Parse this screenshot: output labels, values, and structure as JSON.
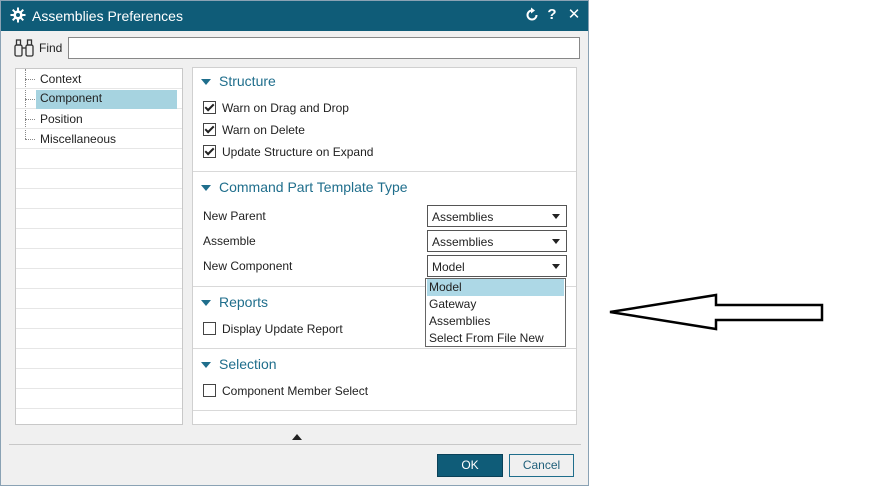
{
  "window": {
    "title": "Assemblies Preferences",
    "title_bar_color": "#0f5c78",
    "buttons": {
      "reset_icon": "reset-icon",
      "help_glyph": "?",
      "close_glyph": "✕"
    }
  },
  "find": {
    "label": "Find",
    "value": "",
    "placeholder": ""
  },
  "tree": {
    "items": [
      {
        "label": "Context",
        "selected": false
      },
      {
        "label": "Component",
        "selected": true
      },
      {
        "label": "Position",
        "selected": false
      },
      {
        "label": "Miscellaneous",
        "selected": false
      }
    ]
  },
  "sections": {
    "structure": {
      "title": "Structure",
      "options": [
        {
          "label": "Warn on Drag and Drop",
          "checked": true
        },
        {
          "label": "Warn on Delete",
          "checked": true
        },
        {
          "label": "Update Structure on Expand",
          "checked": true
        }
      ]
    },
    "template": {
      "title": "Command Part Template Type",
      "fields": [
        {
          "label": "New Parent",
          "value": "Assemblies"
        },
        {
          "label": "Assemble",
          "value": "Assemblies"
        },
        {
          "label": "New Component",
          "value": "Model"
        }
      ],
      "dropdown_options": [
        "Model",
        "Gateway",
        "Assemblies",
        "Select From File New"
      ],
      "dropdown_highlight": "Model"
    },
    "reports": {
      "title": "Reports",
      "options": [
        {
          "label": "Display Update Report",
          "checked": false
        }
      ]
    },
    "selection": {
      "title": "Selection",
      "options": [
        {
          "label": "Component Member Select",
          "checked": false
        }
      ]
    }
  },
  "footer": {
    "ok_label": "OK",
    "cancel_label": "Cancel"
  },
  "colors": {
    "accent": "#1f6e8c",
    "selection": "#a6d3e0",
    "ok_button": "#0f5c78"
  }
}
